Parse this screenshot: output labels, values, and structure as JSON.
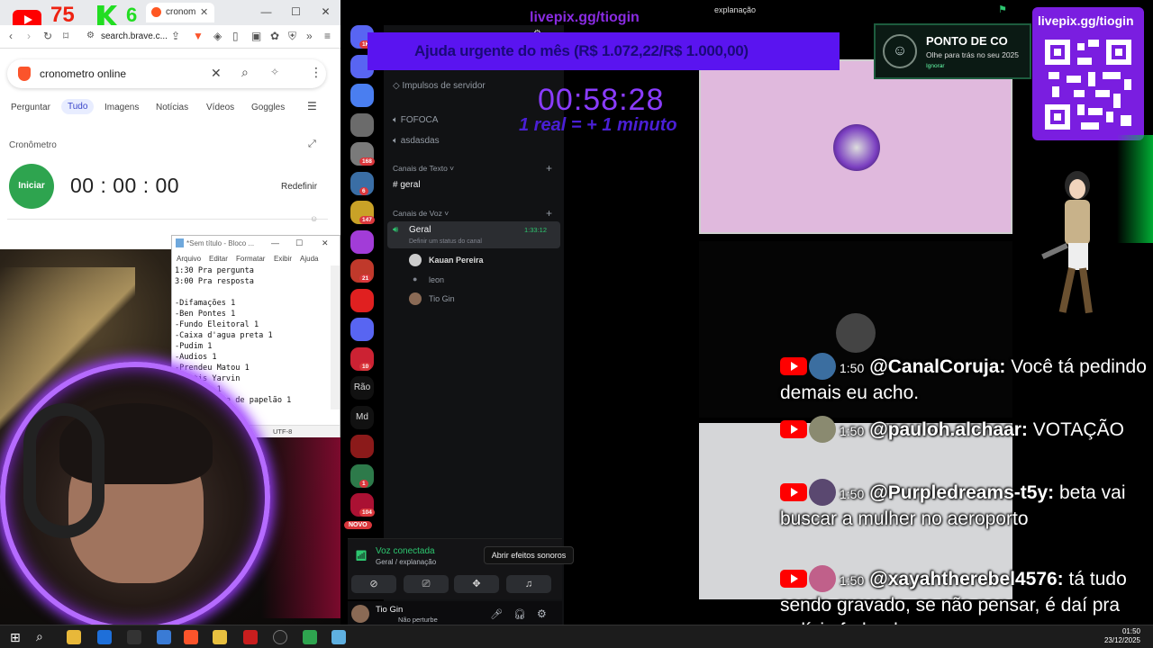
{
  "browser": {
    "tab_title": "cronom",
    "url": "search.brave.c...",
    "search_query": "cronometro online",
    "tabs": [
      "Perguntar",
      "Tudo",
      "Imagens",
      "Notícias",
      "Vídeos",
      "Goggles"
    ],
    "active_tab": "Tudo"
  },
  "stopwatch": {
    "title": "Cronômetro",
    "start_label": "Iniciar",
    "time": "00 : 00 : 00",
    "reset_label": "Redefinir"
  },
  "overlay_counters": {
    "yt_count": "75",
    "k_count": "6"
  },
  "notepad": {
    "title": "*Sem título - Bloco ...",
    "menu": [
      "Arquivo",
      "Editar",
      "Formatar",
      "Exibir",
      "Ajuda"
    ],
    "content": "1:30 Pra pergunta\n3:00 Pra resposta\n\n-Difamações 1\n-Ben Pontes 1\n-Fundo Eleitoral 1\n-Caixa d'agua preta 1\n-Pudim 1\n-Audios 1\n-Prendeu Matou 1\n-Curtis Yarvin\n-gentili 1\n-Homem caixa de papelão 1",
    "encoding": "UTF-8"
  },
  "discord": {
    "servers": [
      {
        "badge": "1K",
        "color": "#5865f2"
      },
      {
        "badge": "",
        "color": "#5865f2"
      },
      {
        "badge": "",
        "color": "#4a7ef0"
      },
      {
        "badge": "",
        "color": "#6b6b6b"
      },
      {
        "badge": "168",
        "color": "#7a7a7a"
      },
      {
        "badge": "6",
        "color": "#3a6ea5"
      },
      {
        "badge": "147",
        "color": "#c9a227"
      },
      {
        "badge": "",
        "color": "#a23cd8"
      },
      {
        "badge": "21",
        "color": "#c0392b"
      },
      {
        "badge": "",
        "color": "#e02020"
      },
      {
        "badge": "",
        "color": "#5865f2"
      },
      {
        "badge": "10",
        "color": "#cc2233"
      },
      {
        "label": "Rão"
      },
      {
        "label": "Md"
      },
      {
        "badge": "",
        "color": "#8b1a1a"
      },
      {
        "badge": "1",
        "color": "#2d7a4a"
      },
      {
        "badge": "104",
        "color": "#aa1133"
      }
    ],
    "new_badge": "NOVO",
    "server_boosts": "Impulsos de servidor",
    "channels_top": [
      "FOFOCA",
      "asdasdas"
    ],
    "text_category": "Canais de Texto",
    "text_channel": "geral",
    "voice_category": "Canais de Voz",
    "voice_channel": "Geral",
    "voice_duration": "1:33:12",
    "voice_status_hint": "Definir um status do canal",
    "voice_members": [
      "Kauan Pereira",
      "leon",
      "Tio Gin"
    ],
    "voice_connected": "Voz conectada",
    "voice_location": "Geral / explanação",
    "tooltip": "Abrir efeitos sonoros",
    "user_name": "Tio Gin",
    "user_status": "Não perturbe",
    "channel_header": "explanação"
  },
  "stream_overlay": {
    "livepix_url": "livepix.gg/tiogin",
    "goal_text": "Ajuda urgente do mês (R$ 1.072,22/R$ 1.000,00)",
    "timer": "00:58:28",
    "timer_rule": "1 real = + 1 minuto",
    "notif_title": "PONTO DE CO",
    "notif_sub": "Olhe para trás no seu 2025",
    "notif_ignore": "Ignorar",
    "qr_label": "livepix.gg/tiogin"
  },
  "chat": [
    {
      "time": "1:50",
      "user": "@CanalCoruja:",
      "text": "Você tá pedindo demais eu acho.",
      "avatar": "#3b6ea0"
    },
    {
      "time": "1:50",
      "user": "@pauloh.alchaar:",
      "text": "VOTAÇÃO",
      "avatar": "#8a8a70"
    },
    {
      "time": "1:50",
      "user": "@Purpledreams-t5y:",
      "text": "beta vai buscar a mulher no aeroporto",
      "avatar": "#5a4870"
    },
    {
      "time": "1:50",
      "user": "@xayahtherebel4576:",
      "text": "tá tudo sendo gravado, se não pensar, é daí pra polícia federal",
      "avatar": "#c0608a"
    }
  ],
  "taskbar": {
    "time": "01:50",
    "date": "23/12/2025"
  }
}
